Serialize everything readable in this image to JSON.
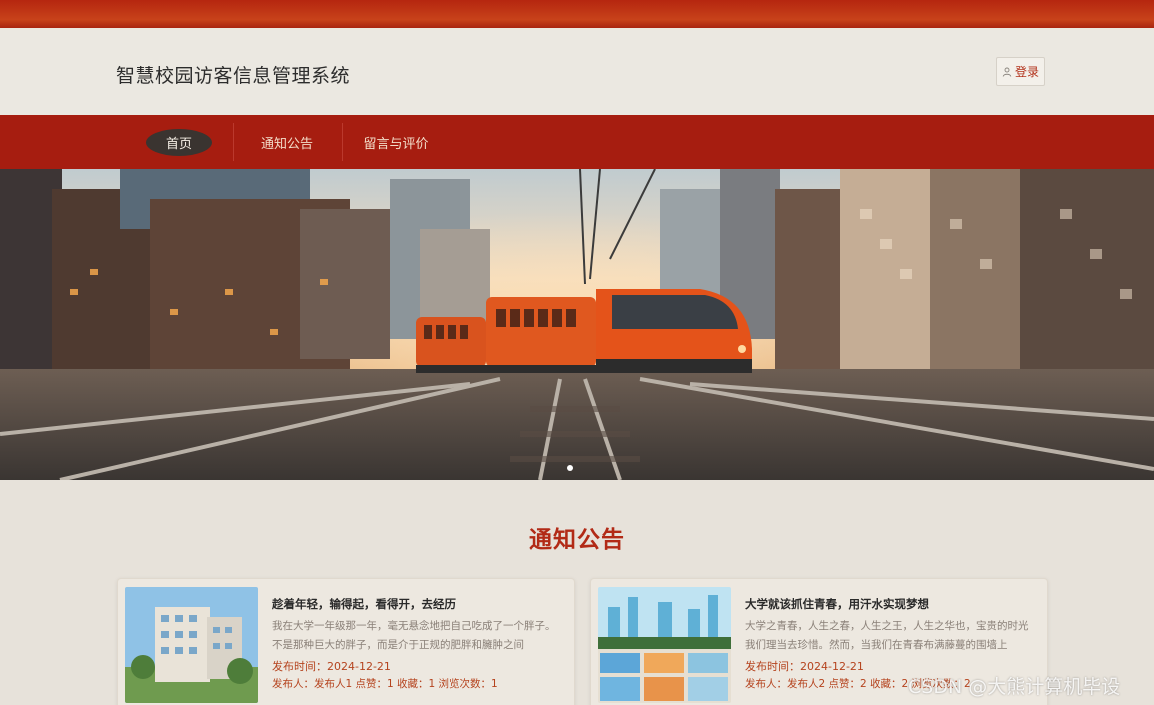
{
  "header": {
    "site_title": "智慧校园访客信息管理系统",
    "login_label": "登录"
  },
  "nav": {
    "items": [
      {
        "label": "首页",
        "active": true
      },
      {
        "label": "通知公告",
        "active": false
      },
      {
        "label": "留言与评价",
        "active": false
      }
    ]
  },
  "banner": {
    "slide_count": 1,
    "active_slide": 1
  },
  "notices": {
    "section_title": "通知公告",
    "items": [
      {
        "title": "趁着年轻，输得起，看得开，去经历",
        "desc": "我在大学一年级那一年，毫无悬念地把自己吃成了一个胖子。不是那种巨大的胖子，而是介于正规的肥胖和臃肿之间",
        "date_label": "发布时间：",
        "date": "2024-12-21",
        "meta": "发布人：发布人1  点赞：1  收藏：1  浏览次数：1"
      },
      {
        "title": "大学就该抓住青春，用汗水实现梦想",
        "desc": "大学之青春，人生之春，人生之王，人生之华也，宝贵的时光我们理当去珍惜。然而，当我们在青春布满藤蔓的围墙上",
        "date_label": "发布时间：",
        "date": "2024-12-21",
        "meta": "发布人：发布人2  点赞：2  收藏：2  浏览次数：2"
      }
    ]
  },
  "watermark": "CSDN @大熊计算机毕设",
  "colors": {
    "brand_red": "#a61d10",
    "accent_orange": "#b5431e",
    "title_red": "#b22a16"
  }
}
